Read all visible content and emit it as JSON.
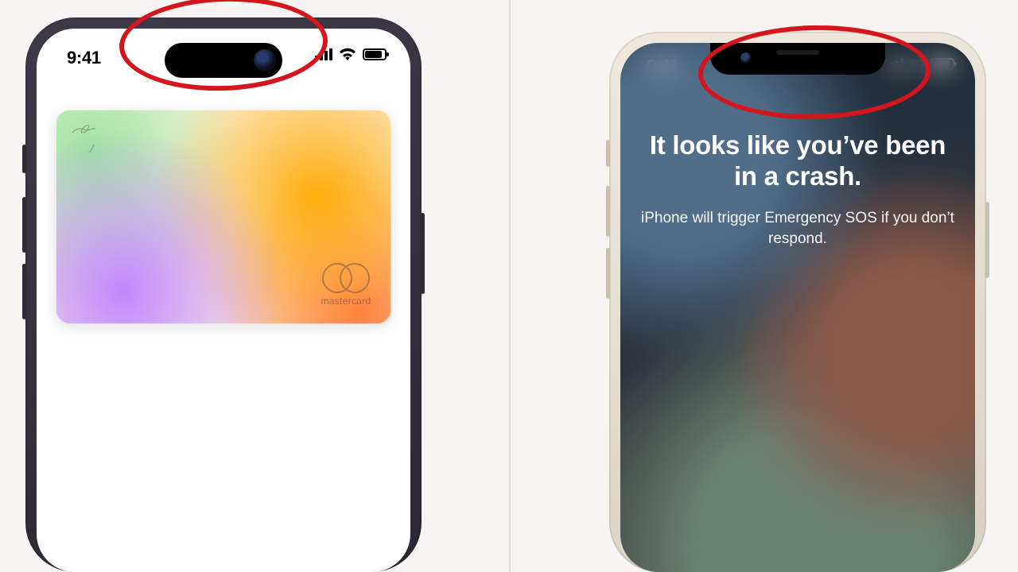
{
  "left": {
    "status": {
      "time": "9:41"
    },
    "card": {
      "brand_label": "mastercard"
    }
  },
  "right": {
    "status": {
      "time": "9:41",
      "network_label": "5G"
    },
    "crash": {
      "headline": "It looks like you’ve been in a crash.",
      "subline": "iPhone will trigger Emergency SOS if you don’t respond."
    }
  },
  "annotation": {
    "color": "#d4151b",
    "targets": [
      "dynamic-island",
      "notch"
    ]
  }
}
